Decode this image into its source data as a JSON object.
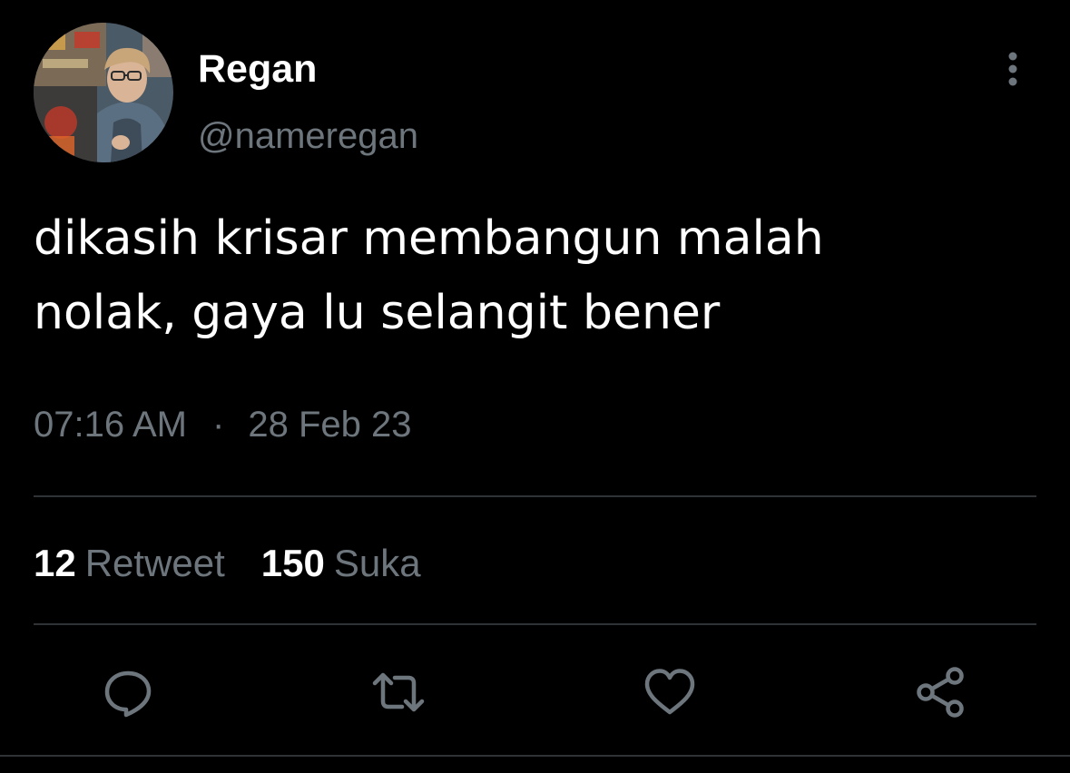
{
  "author": {
    "display_name": "Regan",
    "handle": "@nameregan"
  },
  "tweet": {
    "text_lines": [
      "dikasih krisar membangun malah",
      "nolak, gaya lu selangit bener"
    ],
    "time": "07:16 AM",
    "separator": "·",
    "date": "28 Feb 23"
  },
  "stats": {
    "retweets": {
      "count": "12",
      "label": "Retweet"
    },
    "likes": {
      "count": "150",
      "label": "Suka"
    }
  },
  "icons": {
    "more": "more-vertical-icon",
    "reply": "reply-icon",
    "retweet": "retweet-icon",
    "like": "heart-icon",
    "share": "share-icon"
  },
  "colors": {
    "background": "#000000",
    "primary_text": "#ffffff",
    "secondary_text": "#6e767d",
    "divider": "#2f3336"
  }
}
